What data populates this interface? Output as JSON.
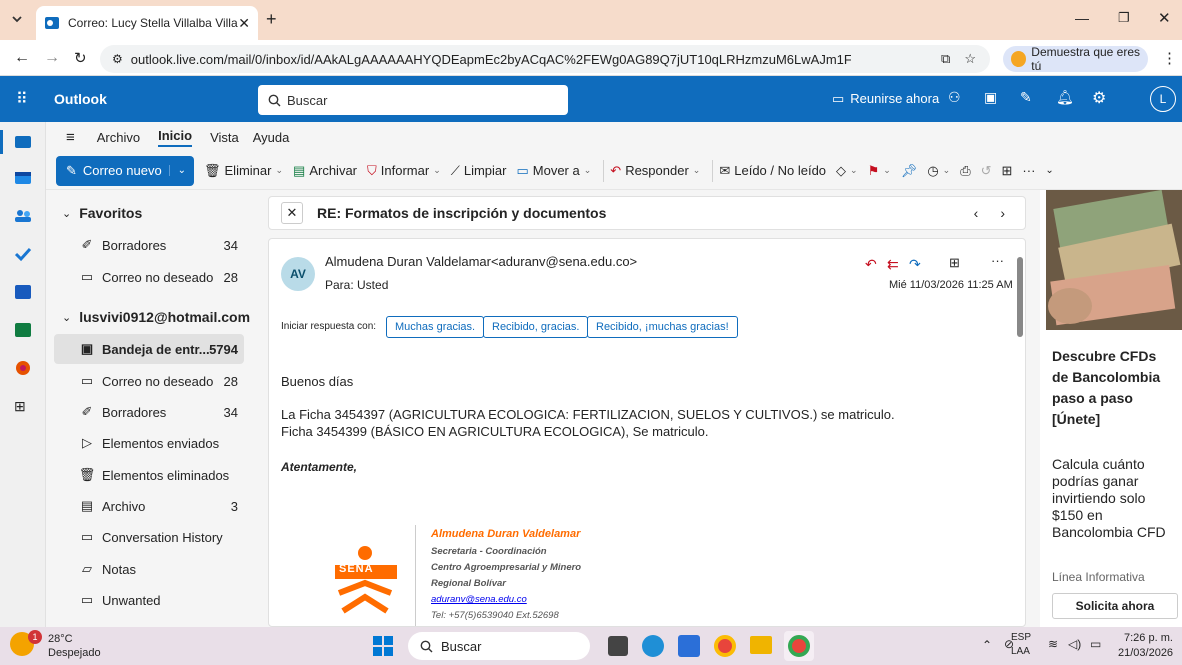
{
  "browser": {
    "tab_title": "Correo: Lucy Stella Villalba Villa",
    "url": "outlook.live.com/mail/0/inbox/id/AAkALgAAAAAAHYQDEapmEc2byACqAC%2FEWg0AG89Q7jUT10qLRHzmzuM6LwAJm1F70QAA",
    "verify_label": "Demuestra que eres tú"
  },
  "outlook": {
    "app_name": "Outlook",
    "search_placeholder": "Buscar",
    "meet_now": "Reunirse ahora",
    "avatar_initial": "L"
  },
  "ribbon_tabs": [
    "Archivo",
    "Inicio",
    "Vista",
    "Ayuda"
  ],
  "ribbon": {
    "new_mail": "Correo nuevo",
    "delete": "Eliminar",
    "archive": "Archivar",
    "report": "Informar",
    "sweep": "Limpiar",
    "move": "Mover a",
    "reply": "Responder",
    "read_unread": "Leído / No leído"
  },
  "folders": {
    "favorites_title": "Favoritos",
    "favorites": [
      {
        "label": "Borradores",
        "count": "34"
      },
      {
        "label": "Correo no deseado",
        "count": "28"
      }
    ],
    "account_title": "lusvivi0912@hotmail.com",
    "account": [
      {
        "label": "Bandeja de entr...",
        "count": "5794"
      },
      {
        "label": "Correo no deseado",
        "count": "28"
      },
      {
        "label": "Borradores",
        "count": "34"
      },
      {
        "label": "Elementos enviados",
        "count": ""
      },
      {
        "label": "Elementos eliminados",
        "count": ""
      },
      {
        "label": "Archivo",
        "count": "3"
      },
      {
        "label": "Conversation History",
        "count": ""
      },
      {
        "label": "Notas",
        "count": ""
      },
      {
        "label": "Unwanted",
        "count": ""
      }
    ]
  },
  "message": {
    "subject": "RE: Formatos de inscripción y documentos",
    "sender_initials": "AV",
    "sender": "Almudena Duran Valdelamar<aduranv@sena.edu.co>",
    "to": "Para:  Usted",
    "date": "Mié 11/03/2026 11:25 AM",
    "quick_reply_label": "Iniciar respuesta con:",
    "quick_replies": [
      "Muchas gracias.",
      "Recibido, gracias.",
      "Recibido, ¡muchas gracias!"
    ],
    "greeting": "Buenos días",
    "line1": "La Ficha 3454397 (AGRICULTURA ECOLOGICA: FERTILIZACION, SUELOS Y CULTIVOS.) se matriculo.",
    "line2": "Ficha 3454399 (BÁSICO EN AGRICULTURA ECOLOGICA), Se matriculo.",
    "closing": "Atentamente,",
    "signature": {
      "logo_text": "SENA",
      "name": "Almudena Duran Valdelamar",
      "role": "Secretaria - Coordinación",
      "center": "Centro Agroempresarial y Minero",
      "region": "Regional Bolívar",
      "email": "aduranv@sena.edu.co",
      "tel": "Tel: +57(5)6539040 Ext.52698"
    }
  },
  "ad": {
    "headline": "Descubre CFDs de Bancolombia paso a paso [Únete]",
    "body": "Calcula cuánto podrías ganar invirtiendo solo $150 en Bancolombia CFD",
    "source": "Línea Informativa",
    "cta": "Solicita ahora"
  },
  "taskbar": {
    "temp": "28°C",
    "weather": "Despejado",
    "weather_badge": "1",
    "search": "Buscar",
    "lang1": "ESP",
    "lang2": "LAA",
    "time": "7:26 p. m.",
    "date": "21/03/2026"
  },
  "colors": {
    "accent": "#0f6cbd",
    "sena_orange": "#ff6c00",
    "tabstrip": "#f6dccb"
  }
}
